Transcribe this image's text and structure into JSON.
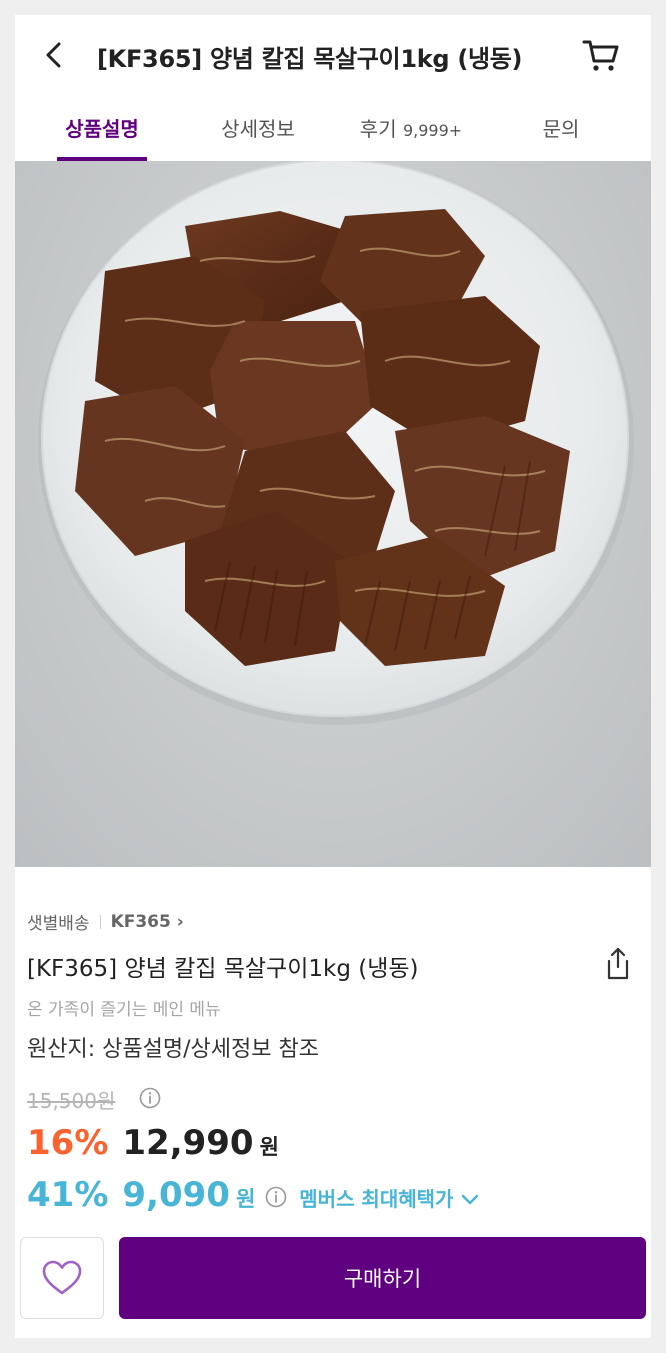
{
  "header": {
    "title": "[KF365] 양념 칼집 목살구이1kg (냉동)"
  },
  "tabs": [
    {
      "label": "상품설명",
      "active": true
    },
    {
      "label": "상세정보"
    },
    {
      "label": "후기",
      "count": "9,999+"
    },
    {
      "label": "문의"
    }
  ],
  "product": {
    "delivery": "샛별배송",
    "brand": "KF365",
    "brand_chevron": "›",
    "name": "[KF365] 양념 칼집 목살구이1kg (냉동)",
    "subtitle": "온 가족이 즐기는 메인 메뉴",
    "origin": "원산지: 상품설명/상세정보 참조",
    "original_price": "15,500원",
    "discount_rate": "16%",
    "price": "12,990",
    "currency": "원",
    "member_discount_rate": "41%",
    "member_price": "9,090",
    "member_label": "멤버스 최대혜택가"
  },
  "actions": {
    "buy_label": "구매하기"
  },
  "colors": {
    "brand_purple": "#5f0080",
    "discount_orange": "#fa622f",
    "member_blue": "#48b5d6"
  },
  "icons": [
    "back-arrow-icon",
    "cart-icon",
    "share-icon",
    "info-icon",
    "chevron-down-icon",
    "heart-icon"
  ]
}
